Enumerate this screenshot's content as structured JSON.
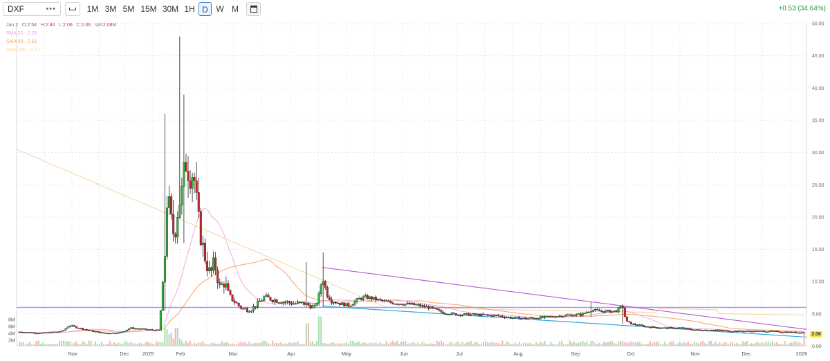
{
  "toolbar": {
    "symbol": "DXF",
    "timeframes": [
      "1M",
      "3M",
      "5M",
      "15M",
      "30M",
      "1H",
      "D",
      "W",
      "M"
    ],
    "active_timeframe": "D",
    "change": "+0.53 (34.64%)"
  },
  "legend": {
    "date": "Jan 2",
    "open_label": "O:",
    "open": "2.54",
    "high_label": "H:",
    "high": "2.84",
    "low_label": "L:",
    "low": "2.06",
    "close_label": "C:",
    "close": "2.06",
    "vol_label": "Vol:",
    "vol": "2.08M",
    "sma20": "SMA 20 - 2.29",
    "sma50": "SMA 50 - 2.51",
    "sma200": "SMA 200 - 4.77"
  },
  "colors": {
    "up": "#2fb53a",
    "down": "#c9252f",
    "sma20": "#f2a7dc",
    "sma50": "#f5a364",
    "sma200": "#f7d29f",
    "hline": "#a98ff0",
    "upper_trend": "#b15ad1",
    "lower_trend": "#39a7d8",
    "last_price_bg": "#f6e44c",
    "positive_change": "#1a9b3e"
  },
  "chart_data": {
    "type": "candlestick",
    "price_axis": {
      "min": 0,
      "max": 50,
      "ticks": [
        "0.00",
        "5.00",
        "10.00",
        "15.00",
        "20.00",
        "25.00",
        "30.00",
        "35.00",
        "40.00",
        "45.00",
        "50.00"
      ]
    },
    "volume_axis": {
      "ticks": [
        "2M",
        "4M",
        "6M",
        "8M"
      ]
    },
    "x_labels": [
      "Nov",
      "Dec",
      "2025",
      "Feb",
      "Mar",
      "Apr",
      "May",
      "Jun",
      "Jul",
      "Aug",
      "Sep",
      "Oct",
      "Nov",
      "Dec",
      "2026"
    ],
    "last_price": "2.06",
    "horizontal_line": 6.0,
    "trendlines": [
      {
        "name": "upper",
        "from": [
          "2025-04-17",
          12.2
        ],
        "to": [
          "2026-01-02",
          2.6
        ]
      },
      {
        "name": "lower",
        "from": [
          "2025-04-17",
          6.2
        ],
        "to": [
          "2026-01-02",
          1.4
        ]
      }
    ],
    "grid": true
  }
}
